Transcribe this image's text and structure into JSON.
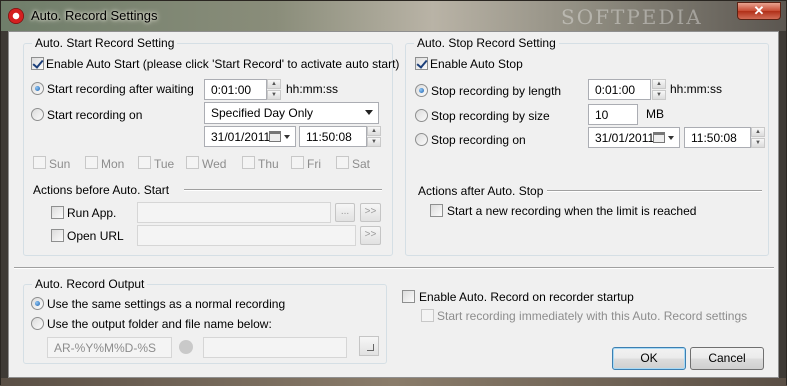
{
  "window": {
    "title": "Auto. Record Settings",
    "watermark": "SOFTPEDIA",
    "close_label": "✕"
  },
  "start_group": {
    "title": "Auto. Start Record Setting",
    "enable_label": "Enable Auto Start (please click 'Start Record' to activate auto start)",
    "after_waiting_label": "Start recording after waiting",
    "wait_value": "0:01:00",
    "wait_unit": "hh:mm:ss",
    "on_label": "Start recording on",
    "day_select_value": "Specified Day Only",
    "date_value": "31/01/2011",
    "time_value": "11:50:08",
    "days": [
      "Sun",
      "Mon",
      "Tue",
      "Wed",
      "Thu",
      "Fri",
      "Sat"
    ]
  },
  "actions_before": {
    "title": "Actions before Auto. Start",
    "run_app_label": "Run App.",
    "open_url_label": "Open URL",
    "browse_label": "...",
    "go_label": ">>"
  },
  "stop_group": {
    "title": "Auto. Stop Record Setting",
    "enable_label": "Enable Auto Stop",
    "by_length_label": "Stop recording by length",
    "length_value": "0:01:00",
    "length_unit": "hh:mm:ss",
    "by_size_label": "Stop recording by size",
    "size_value": "10",
    "size_unit": "MB",
    "on_label": "Stop recording on",
    "date_value": "31/01/2011",
    "time_value": "11:50:08"
  },
  "actions_after": {
    "title": "Actions after Auto. Stop",
    "new_recording_label": "Start a new recording when the limit is reached"
  },
  "output_group": {
    "title": "Auto. Record Output",
    "same_settings_label": "Use the same settings as a normal recording",
    "output_folder_label": "Use the output folder and file name below:",
    "filename_pattern": "AR-%Y%M%D-%S"
  },
  "startup": {
    "enable_label": "Enable Auto. Record on recorder startup",
    "immediate_label": "Start recording immediately with this Auto. Record settings"
  },
  "buttons": {
    "ok": "OK",
    "cancel": "Cancel"
  }
}
